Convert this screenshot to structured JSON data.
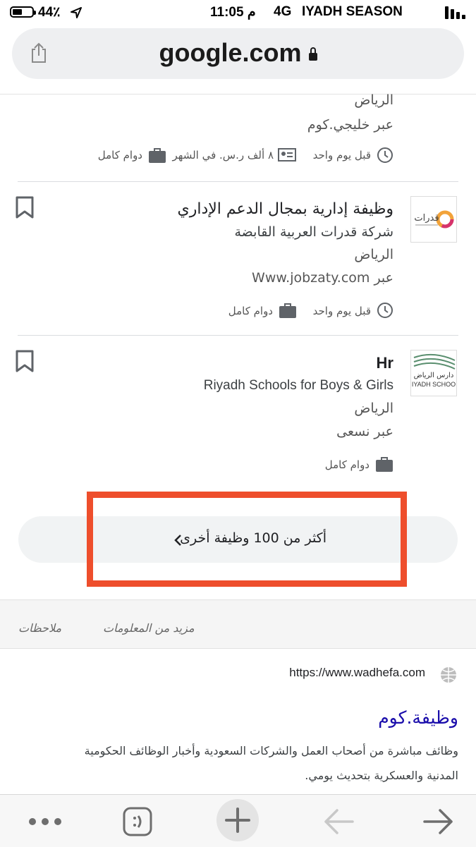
{
  "status_bar": {
    "battery": "44٪",
    "time": "11:05 م",
    "network": "4G",
    "carrier": "IYADH SEASON"
  },
  "browser": {
    "url": "google.com"
  },
  "previous_job": {
    "location": "الرياض",
    "via": "عبر خليجي.كوم",
    "posted": "قبل يوم واحد",
    "salary": "٨ ألف ر.س. في الشهر",
    "type": "دوام كامل"
  },
  "jobs": [
    {
      "title": "وظيفة إدارية بمجال الدعم الإداري",
      "company": "شركة قدرات العربية القابضة",
      "location": "الرياض",
      "via": "عبر Www.jobzaty.com",
      "posted": "قبل يوم واحد",
      "type": "دوام كامل",
      "logo_text": "قدرات"
    },
    {
      "title": "Hr",
      "company": "Riyadh Schools for Boys & Girls",
      "location": "الرياض",
      "via": "عبر نسعى",
      "type": "دوام كامل",
      "logo_text_ar": "دارس الرياض",
      "logo_text_en": "IYADH SCHOO"
    }
  ],
  "more_jobs_label": "أكثر من 100 وظيفة أخرى",
  "links": {
    "more_info": "مزيد من المعلومات",
    "feedback": "ملاحظات"
  },
  "result": {
    "url": "https://www.wadhefa.com",
    "title": "وظيفة.كوم",
    "snippet_line1": "وظائف مباشرة من أصحاب العمل والشركات السعودية وأخبار الوظائف الحكومية",
    "snippet_line2": "المدنية والعسكرية بتحديث يومي."
  },
  "colors": {
    "highlight_box": "#ee4e2c",
    "link_blue": "#1a0dab",
    "icon_gray": "#5f6368"
  },
  "icons": [
    "share-icon",
    "lock-icon",
    "clock-icon",
    "salary-icon",
    "briefcase-icon",
    "bookmark-icon",
    "chevron-left-icon",
    "globe-icon",
    "more-dots-icon",
    "tabs-icon",
    "new-tab-plus-icon",
    "back-arrow-icon",
    "forward-arrow-icon"
  ]
}
